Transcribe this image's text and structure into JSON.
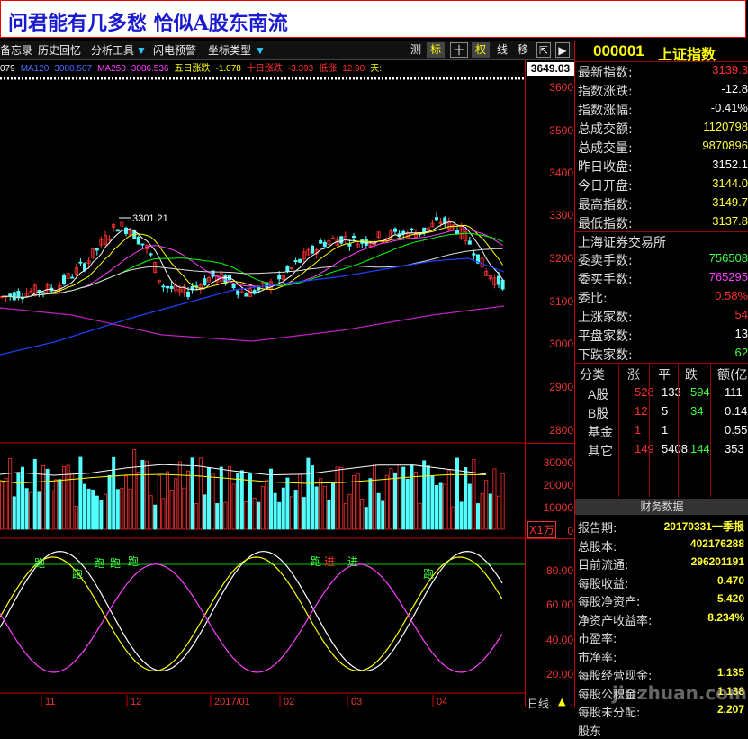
{
  "banner": {
    "title": "问君能有几多愁 恰似A股东南流"
  },
  "toolbar": {
    "items": [
      "备忘录",
      "历史回忆",
      "分析工具",
      "闪电预警",
      "坐标类型"
    ],
    "buttons": [
      "测",
      "标",
      "十",
      "权",
      "线",
      "移"
    ]
  },
  "infobar": {
    "items": [
      {
        "text": "079",
        "color": "#ffffff"
      },
      {
        "text": "MA120",
        "color": "#4a6cff"
      },
      {
        "text": "3080.507",
        "color": "#4a6cff"
      },
      {
        "text": "MA250",
        "color": "#ff40ff"
      },
      {
        "text": "3086.536",
        "color": "#ff40ff"
      },
      {
        "text": "五日涨跌",
        "color": "#ffff00"
      },
      {
        "text": "-1.078",
        "color": "#ffff00"
      },
      {
        "text": "十日涨跌",
        "color": "#ff3030"
      },
      {
        "text": "-3.393",
        "color": "#ff3030"
      },
      {
        "text": "低涨",
        "color": "#ff3030"
      },
      {
        "text": "12.90",
        "color": "#ff3030"
      },
      {
        "text": "天:",
        "color": "#ffff00"
      }
    ]
  },
  "axis": {
    "price_box": "3649.03",
    "price_labels": [
      "3600",
      "3500",
      "3400",
      "3300",
      "3200",
      "3100",
      "3000",
      "2900",
      "2800"
    ],
    "volume_labels": [
      "30000",
      "20000",
      "10000",
      "0"
    ],
    "volume_unit": "X1万",
    "osc_labels": [
      "80.00",
      "60.00",
      "40.00",
      "20.00"
    ],
    "date_label": "日线"
  },
  "chart": {
    "peak_label": "3301.21",
    "date_ticks": [
      "11",
      "12",
      "2017/01",
      "02",
      "03",
      "04"
    ],
    "signal_labels": [
      "跑",
      "跑",
      "跑",
      "跑",
      "跑",
      "跑",
      "进",
      "进",
      "跑"
    ]
  },
  "colors": {
    "up": "#ff3030",
    "down": "#54ffff",
    "ma5": "#ffffff",
    "ma10": "#ffff00",
    "ma20": "#ff40ff",
    "ma30": "#00ff00",
    "ma60": "#e0e0e0",
    "ma120": "#2040ff",
    "ma250": "#c020c0"
  },
  "quote": {
    "code": "000001",
    "name": "上证指数",
    "rows": [
      {
        "k": "最新指数:",
        "v": "3139.3",
        "c": "#ff3030"
      },
      {
        "k": "指数涨跌:",
        "v": "-12.8",
        "c": "#ffffff"
      },
      {
        "k": "指数涨幅:",
        "v": "-0.41%",
        "c": "#ffffff"
      },
      {
        "k": "总成交额:",
        "v": "1120798",
        "c": "#ffff40"
      },
      {
        "k": "总成交量:",
        "v": "9870896",
        "c": "#ffff40"
      },
      {
        "k": "昨日收盘:",
        "v": "3152.1",
        "c": "#ffffff"
      },
      {
        "k": "今日开盘:",
        "v": "3144.0",
        "c": "#ffff40"
      },
      {
        "k": "最高指数:",
        "v": "3149.7",
        "c": "#ffff40"
      },
      {
        "k": "最低指数:",
        "v": "3137.8",
        "c": "#ffff40"
      }
    ],
    "exchange": "上海证券交易所",
    "rows2": [
      {
        "k": "委卖手数:",
        "v": "756508",
        "c": "#40ff40"
      },
      {
        "k": "委买手数:",
        "v": "765295",
        "c": "#ff40ff"
      },
      {
        "k": "委比:",
        "v": "0.58%",
        "c": "#ff3030"
      },
      {
        "k": "上涨家数:",
        "v": "54",
        "c": "#ff3030"
      },
      {
        "k": "平盘家数:",
        "v": "13",
        "c": "#ffffff"
      },
      {
        "k": "下跌家数:",
        "v": "62",
        "c": "#40ff40"
      }
    ],
    "grid_headers": [
      "分类",
      "涨",
      "平",
      "跌",
      "额(亿"
    ],
    "grid_rows": [
      [
        "A股",
        "528",
        "133",
        "594",
        "111"
      ],
      [
        "B股",
        "12",
        "5",
        "34",
        "0.14"
      ],
      [
        "基金",
        "1",
        "1",
        "",
        "0.55"
      ],
      [
        "其它",
        "149",
        "5408",
        "144",
        "353"
      ]
    ]
  },
  "finance": {
    "title": "财务数据",
    "rows": [
      {
        "k": "报告期:",
        "v": "20170331一季报"
      },
      {
        "k": "总股本:",
        "v": "402176288"
      },
      {
        "k": "目前流通:",
        "v": "296201191"
      },
      {
        "k": "每股收益:",
        "v": "0.470"
      },
      {
        "k": "每股净资产:",
        "v": "5.420"
      },
      {
        "k": "净资产收益率:",
        "v": "8.234%"
      },
      {
        "k": "市盈率:",
        "v": ""
      },
      {
        "k": "市净率:",
        "v": ""
      },
      {
        "k": "每股经营现金:",
        "v": "1.135"
      },
      {
        "k": "每股公积金:",
        "v": "1.138"
      },
      {
        "k": "每股未分配:",
        "v": "2.207"
      },
      {
        "k": "股东",
        "v": ""
      }
    ]
  },
  "watermark": "jiuzhuan.com"
}
